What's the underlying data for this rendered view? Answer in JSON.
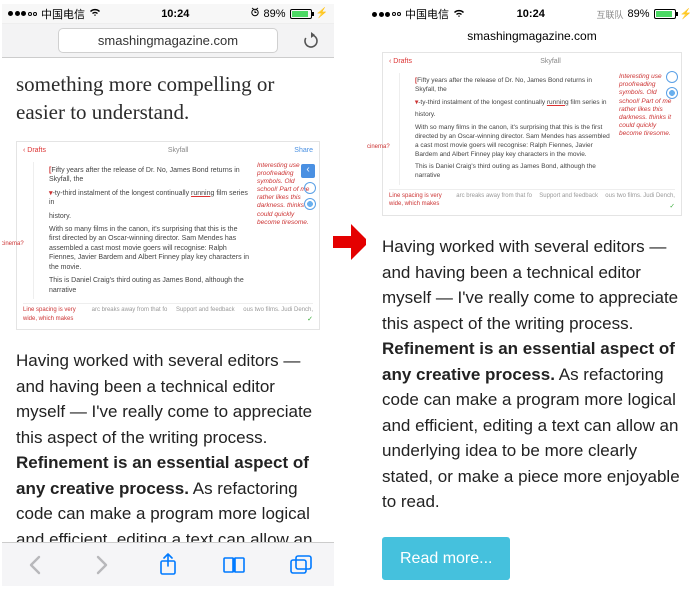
{
  "status": {
    "carrier": "中国电信",
    "time": "10:24",
    "battery_pct": "89%",
    "charge_icon": "⚡",
    "extra_right": "互联队"
  },
  "url": "smashingmagazine.com",
  "lead_text": "something more compelling or easier to understand.",
  "doc": {
    "drafts": "‹ Drafts",
    "tab": "Skyfall",
    "share": "Share",
    "p1a": "Fifty years after the release of Dr. No, James Bond returns in Skyfall, the",
    "p1b": "-ty-third instalment of the longest continually ",
    "p1b_hl": "running",
    "p1b2": " film series in",
    "p1c": "history.",
    "p2": "With so many films in the canon, it's surprising that this is the first directed by an Oscar-winning director. Sam Mendes has assembled a cast most movie goers will recognise: Ralph Fiennes, Javier Bardem and Albert Finney play key characters in the movie.",
    "p3a": "This is Daniel Craig's third outing as James Bond, although the narrative",
    "p3b": "arc breaks away from that fo",
    "p3c": "ous two films. Judi Dench,",
    "sidenote": "Interesting use proofreading symbols. Old school! Part of me rather likes this darkness. thinks it could quickly become tiresome.",
    "linespacing": "Line spacing is very wide, which makes",
    "cinema": "cinema?",
    "support": "Support and feedback"
  },
  "paragraph": {
    "s1": "Having worked with several editors — and having been a technical editor myself — I've really come to appreciate this aspect of the writing process. ",
    "bold": "Refinement is an essential aspect of any creative process.",
    "s2_short": " As refactoring code can make a program more logical and efficient, editing a text can allow an",
    "s2_full": " As refactoring code can make a program more logical and efficient, editing a text can allow an underlying idea to be more clearly stated, or make a piece more enjoyable to read."
  },
  "readmore_label": "Read more...",
  "icons": {
    "reload": "↻",
    "back": "‹",
    "fwd": "›"
  }
}
